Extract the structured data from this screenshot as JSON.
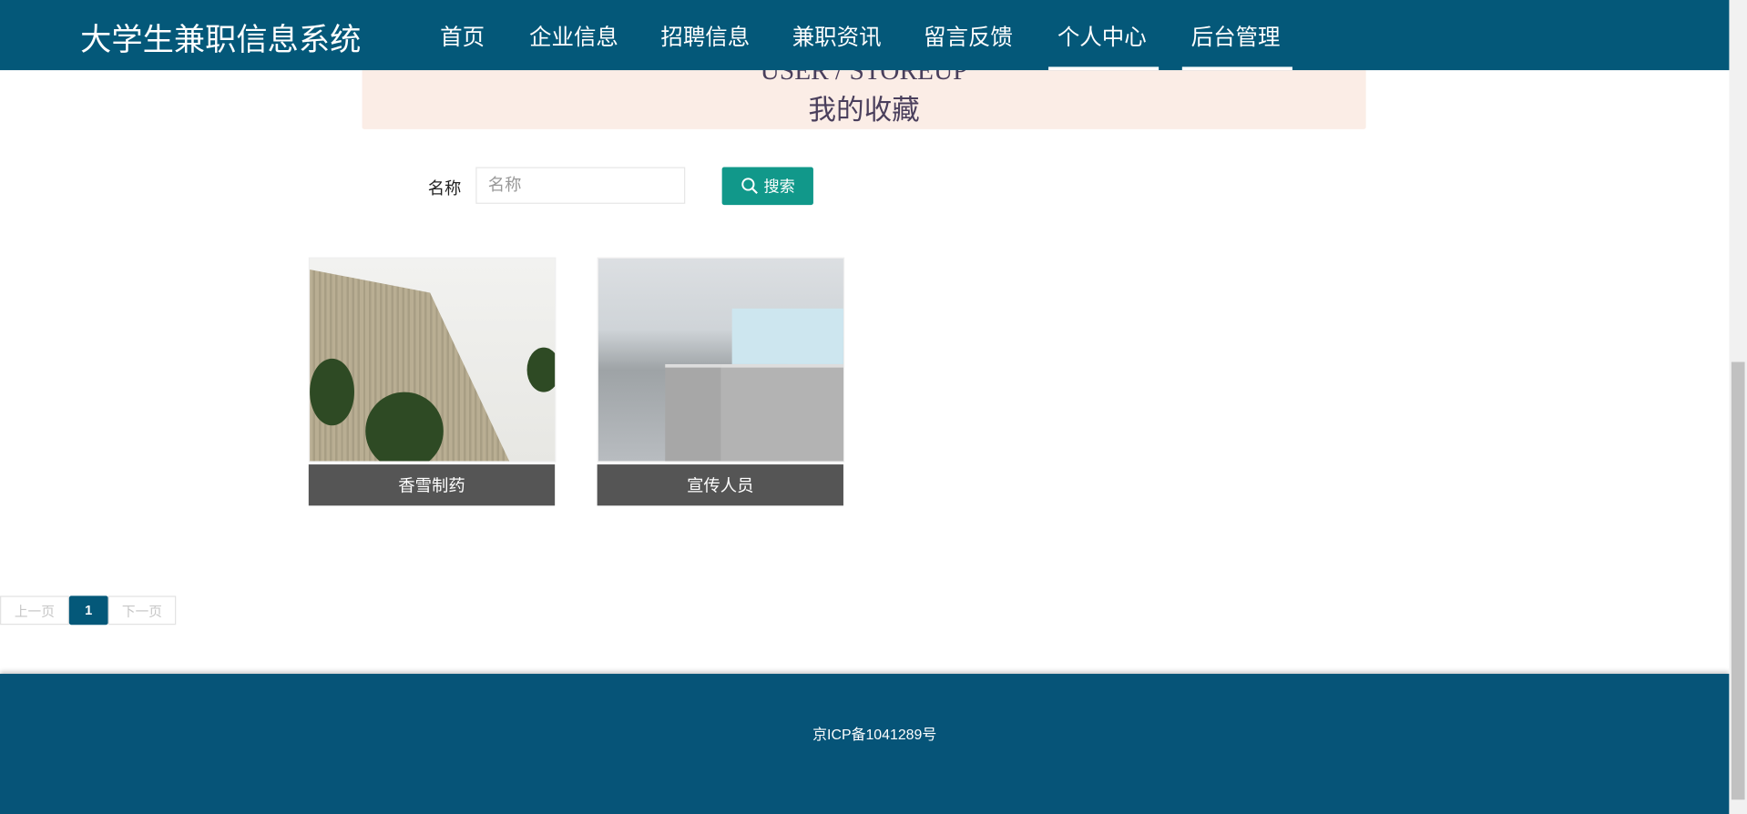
{
  "header": {
    "title": "大学生兼职信息系统",
    "nav": [
      "首页",
      "企业信息",
      "招聘信息",
      "兼职资讯",
      "留言反馈",
      "个人中心",
      "后台管理"
    ]
  },
  "banner": {
    "en": "USER / STOREUP",
    "cn": "我的收藏"
  },
  "search": {
    "label": "名称",
    "placeholder": "名称",
    "value": "",
    "button": "搜索"
  },
  "cards": [
    {
      "title": "香雪制药"
    },
    {
      "title": "宣传人员"
    }
  ],
  "pagination": {
    "prev": "上一页",
    "current": "1",
    "next": "下一页"
  },
  "footer": {
    "icp": "京ICP备1041289号"
  },
  "colors": {
    "header": "#045879",
    "accent_button": "#11988a",
    "banner_bg": "#fbede6",
    "card_label": "#555555"
  }
}
